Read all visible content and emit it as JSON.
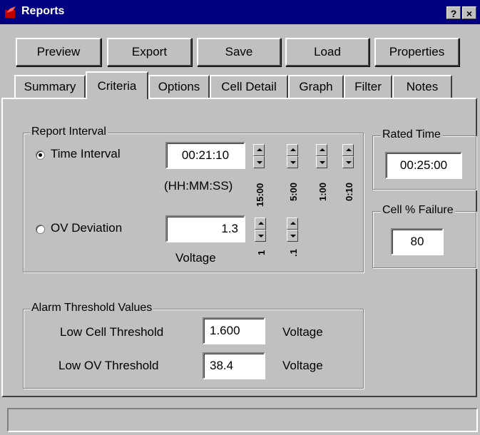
{
  "window": {
    "title": "Reports",
    "help_btn": "?",
    "close_btn": "×"
  },
  "toolbar": {
    "preview": "Preview",
    "export": "Export",
    "save": "Save",
    "load": "Load",
    "properties": "Properties"
  },
  "tabs": [
    "Summary",
    "Criteria",
    "Options",
    "Cell Detail",
    "Graph",
    "Filter",
    "Notes"
  ],
  "active_tab": "Criteria",
  "report_interval": {
    "title": "Report Interval",
    "time_interval": {
      "label": "Time Interval",
      "value": "00:21:10",
      "format": "(HH:MM:SS)",
      "selected": true,
      "steps": [
        "15:00",
        "5:00",
        "1:00",
        "0:10"
      ]
    },
    "ov_deviation": {
      "label": "OV Deviation",
      "value": "1.3",
      "unit": "Voltage",
      "selected": false,
      "steps": [
        "1",
        ".1"
      ]
    }
  },
  "rated_time": {
    "title": "Rated Time",
    "value": "00:25:00"
  },
  "cell_failure": {
    "title": "Cell % Failure",
    "value": "80"
  },
  "alarm": {
    "title": "Alarm Threshold Values",
    "low_cell": {
      "label": "Low Cell Threshold",
      "value": "1.600",
      "unit": "Voltage"
    },
    "low_ov": {
      "label": "Low OV Threshold",
      "value": "38.4",
      "unit": "Voltage"
    }
  },
  "status": {
    "text": ""
  }
}
